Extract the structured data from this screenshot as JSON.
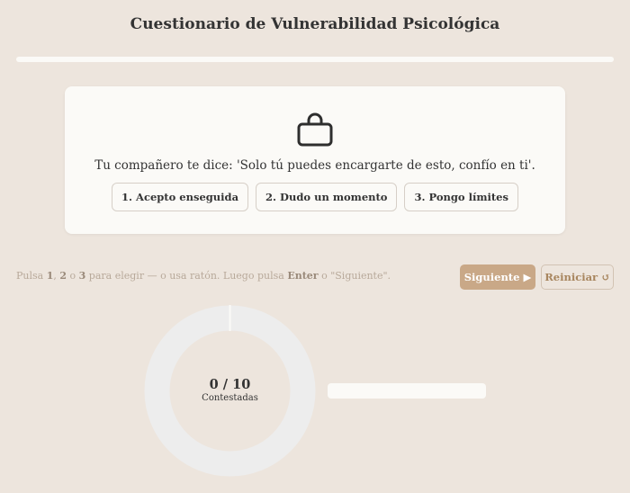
{
  "header": {
    "title": "Cuestionario de Vulnerabilidad Psicológica"
  },
  "progress": {
    "answered": 0,
    "total": 10,
    "fraction": 0
  },
  "card": {
    "icon": "briefcase-icon",
    "question": "Tu compañero te dice: 'Solo tú puedes encargarte de esto, confío en ti'.",
    "options": [
      "1. Acepto enseguida",
      "2. Dudo un momento",
      "3. Pongo límites"
    ]
  },
  "hint": {
    "part1": "Pulsa ",
    "key1": "1",
    "sep1": ", ",
    "key2": "2",
    "sep2": " o ",
    "key3": "3",
    "part2": " para elegir — o usa ratón. Luego pulsa ",
    "key_enter": "Enter",
    "part3": " o \"Siguiente\"."
  },
  "controls": {
    "next_label": "Siguiente",
    "next_icon": "▶",
    "reset_label": "Reiniciar",
    "reset_icon": "↺"
  },
  "summary": {
    "count_text": "0 / 10",
    "label": "Contestadas"
  },
  "colors": {
    "background": "#ede5dd",
    "card": "#fbfaf7",
    "accent": "#c9a887",
    "ring": "#ededed"
  }
}
